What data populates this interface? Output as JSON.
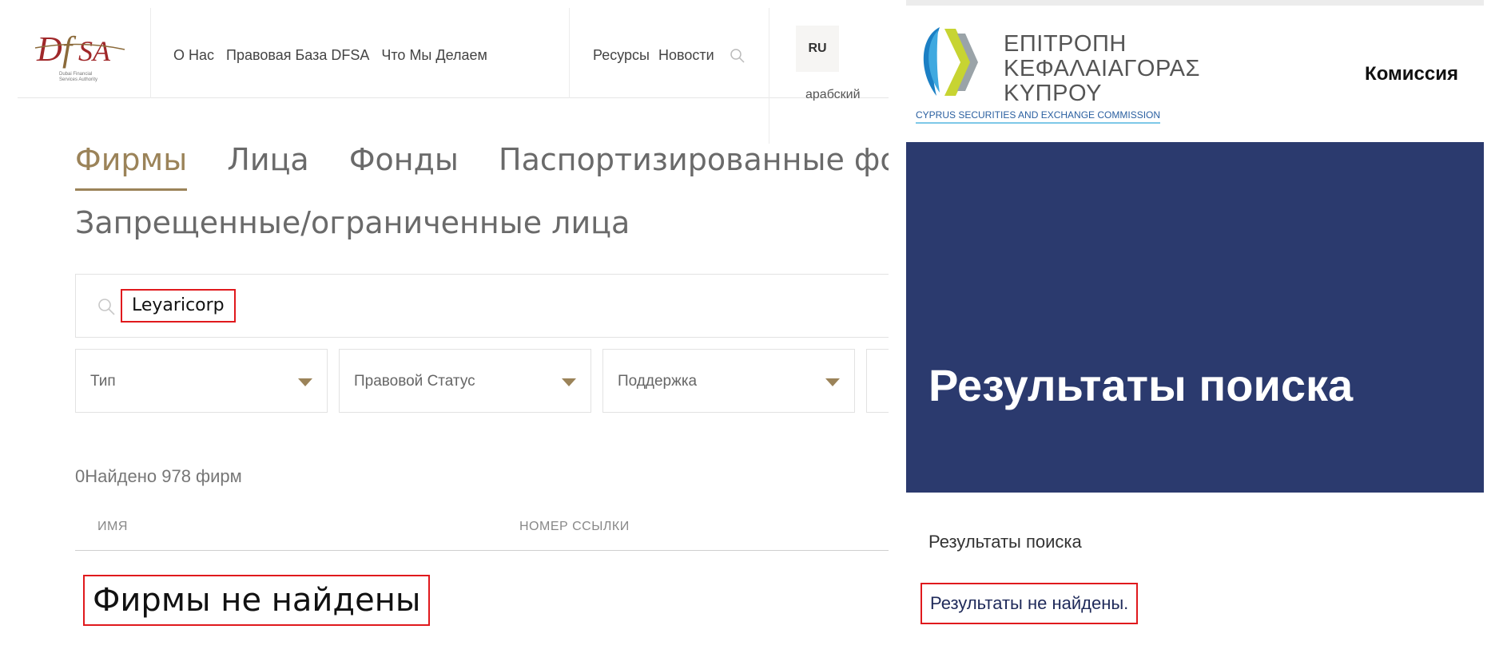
{
  "dfsa": {
    "logo_text": "DFSA",
    "logo_subtitle": "Dubai Financial Services Authority",
    "nav_left": [
      "О Нас",
      "Правовая База DFSA",
      "Что Мы Делаем"
    ],
    "nav_right": [
      "Ресурсы",
      "Новости"
    ],
    "lang_current": "RU",
    "lang_alt": "арабский",
    "tabs": [
      "Фирмы",
      "Лица",
      "Фонды",
      "Паспортизированные фонды"
    ],
    "tab_second_row": "Запрещенные/ограниченные лица",
    "active_tab_index": 0,
    "search": {
      "value": "Leyaricorp"
    },
    "filters": [
      "Тип",
      "Правовой Статус",
      "Поддержка"
    ],
    "result_count": "0Найдено 978 фирм",
    "columns": [
      "ИМЯ",
      "НОМЕР ССЫЛКИ"
    ],
    "empty_message": "Фирмы не найдены"
  },
  "cysec": {
    "title_lines": [
      "ΕΠΙΤΡΟΠΗ",
      "ΚΕΦΑΛΑΙΑΓΟΡΑΣ",
      "ΚΥΠΡΟΥ"
    ],
    "subtitle": "CYPRUS SECURITIES AND EXCHANGE COMMISSION",
    "nav_item": "Комиссия",
    "hero_title": "Результаты поиска",
    "breadcrumb": "Результаты поиска",
    "empty_message": "Результаты не найдены."
  },
  "colors": {
    "dfsa_gold": "#9b8359",
    "cysec_navy": "#2b3a6e",
    "highlight_red": "#e0191d"
  }
}
